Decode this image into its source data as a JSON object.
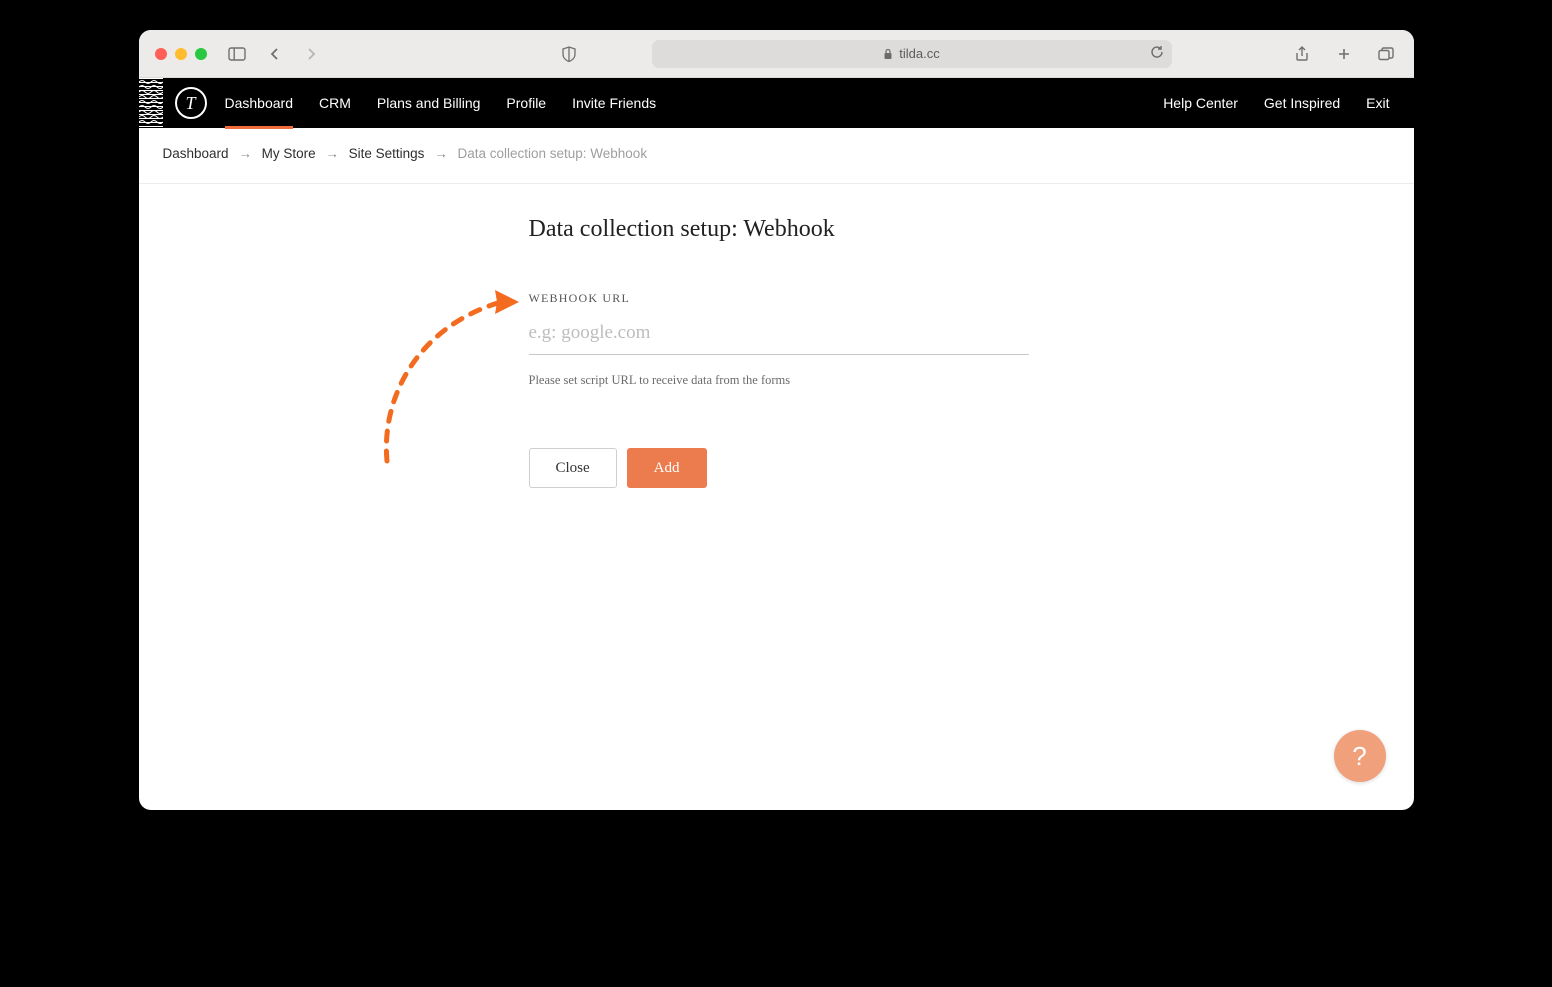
{
  "browser": {
    "url_host": "tilda.cc"
  },
  "nav": {
    "logo_letter": "T",
    "links": [
      "Dashboard",
      "CRM",
      "Plans and Billing",
      "Profile",
      "Invite Friends"
    ],
    "active_index": 0,
    "right_links": [
      "Help Center",
      "Get Inspired",
      "Exit"
    ]
  },
  "breadcrumb": {
    "items": [
      "Dashboard",
      "My Store",
      "Site Settings"
    ],
    "current": "Data collection setup: Webhook"
  },
  "form": {
    "title": "Data collection setup: Webhook",
    "url_label": "WEBHOOK URL",
    "url_placeholder": "e.g: google.com",
    "url_value": "",
    "url_help": "Please set script URL to receive data from the forms",
    "close_label": "Close",
    "add_label": "Add"
  },
  "help_button": "?",
  "colors": {
    "accent": "#ec7c4e",
    "annotation": "#f36b1f"
  }
}
